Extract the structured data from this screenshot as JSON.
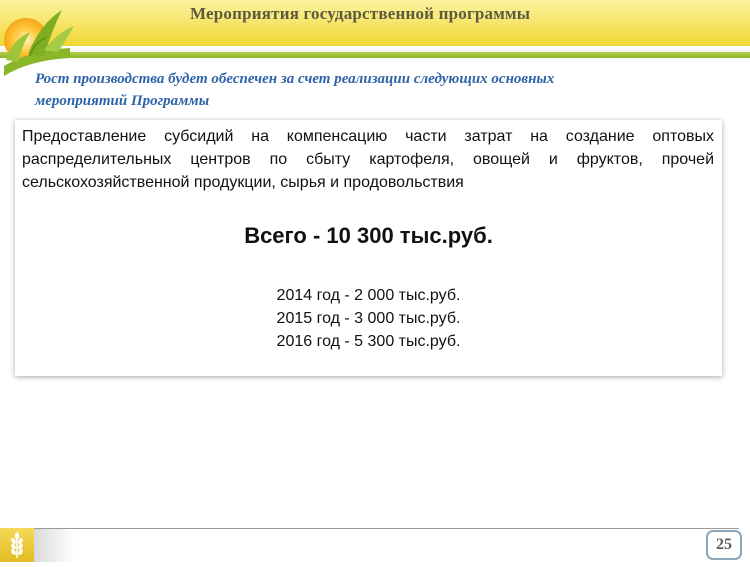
{
  "header": {
    "title": "Мероприятия государственной программы"
  },
  "subtitle": {
    "line1": "Рост производства будет обеспечен за счет реализации следующих основных",
    "line2": "мероприятий Программы"
  },
  "content": {
    "description": "Предоставление субсидий на компенсацию  части  затрат на создание оптовых распределительных центров по сбыту картофеля, овощей и фруктов, прочей сельскохозяйственной продукции, сырья и продовольствия",
    "total": "Всего - 10 300 тыс.руб.",
    "years": [
      "2014 год - 2 000 тыс.руб.",
      "2015 год - 3 000 тыс.руб.",
      "2016 год - 5 300 тыс.руб."
    ]
  },
  "footer": {
    "page_number": "25"
  }
}
